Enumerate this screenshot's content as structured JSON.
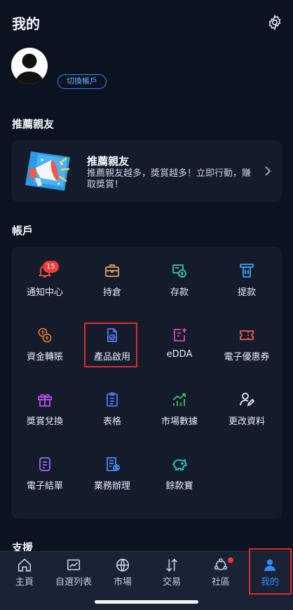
{
  "header": {
    "title": "我的",
    "settings_icon": "gear-icon"
  },
  "profile": {
    "switch_label": "切換帳戶"
  },
  "referral": {
    "section_title": "推薦親友",
    "card_title": "推薦親友",
    "card_desc": "推薦親友越多，獎賞越多！立即行動，賺取獎賞！"
  },
  "account": {
    "section_title": "帳戶",
    "items": [
      {
        "label": "通知中心",
        "icon": "bell-icon",
        "color": "#f0503c",
        "badge": "15"
      },
      {
        "label": "持倉",
        "icon": "briefcase-icon",
        "color": "#e0a060"
      },
      {
        "label": "存款",
        "icon": "deposit-icon",
        "color": "#3cc8a8"
      },
      {
        "label": "提款",
        "icon": "withdraw-icon",
        "color": "#3ca8f0"
      },
      {
        "label": "資金轉賬",
        "icon": "currency-transfer-icon",
        "color": "#f07a28"
      },
      {
        "label": "產品啟用",
        "icon": "document-check-icon",
        "color": "#5a78f0"
      },
      {
        "label": "eDDA",
        "icon": "edda-icon",
        "color": "#e040b0"
      },
      {
        "label": "電子優惠券",
        "icon": "coupon-icon",
        "color": "#f05a4a"
      },
      {
        "label": "獎賞兌換",
        "icon": "gift-icon",
        "color": "#b050f0"
      },
      {
        "label": "表格",
        "icon": "clipboard-icon",
        "color": "#4a7af0"
      },
      {
        "label": "市場數據",
        "icon": "chart-bars-icon",
        "color": "#40c060"
      },
      {
        "label": "更改資料",
        "icon": "user-edit-icon",
        "color": "#e8edf5"
      },
      {
        "label": "電子結單",
        "icon": "statement-icon",
        "color": "#9a6af0"
      },
      {
        "label": "業務辦理",
        "icon": "service-doc-icon",
        "color": "#4a8af0"
      },
      {
        "label": "餘款寶",
        "icon": "piggy-bank-icon",
        "color": "#28c8c8"
      }
    ]
  },
  "support": {
    "section_title": "支援"
  },
  "tabbar": {
    "items": [
      {
        "label": "主頁",
        "icon": "home-icon"
      },
      {
        "label": "自選列表",
        "icon": "watchlist-chart-icon"
      },
      {
        "label": "市場",
        "icon": "globe-icon"
      },
      {
        "label": "交易",
        "icon": "trade-arrows-icon"
      },
      {
        "label": "社區",
        "icon": "community-icon"
      },
      {
        "label": "我的",
        "icon": "user-icon"
      }
    ],
    "active": "我的",
    "active_color": "#2f8bff"
  }
}
